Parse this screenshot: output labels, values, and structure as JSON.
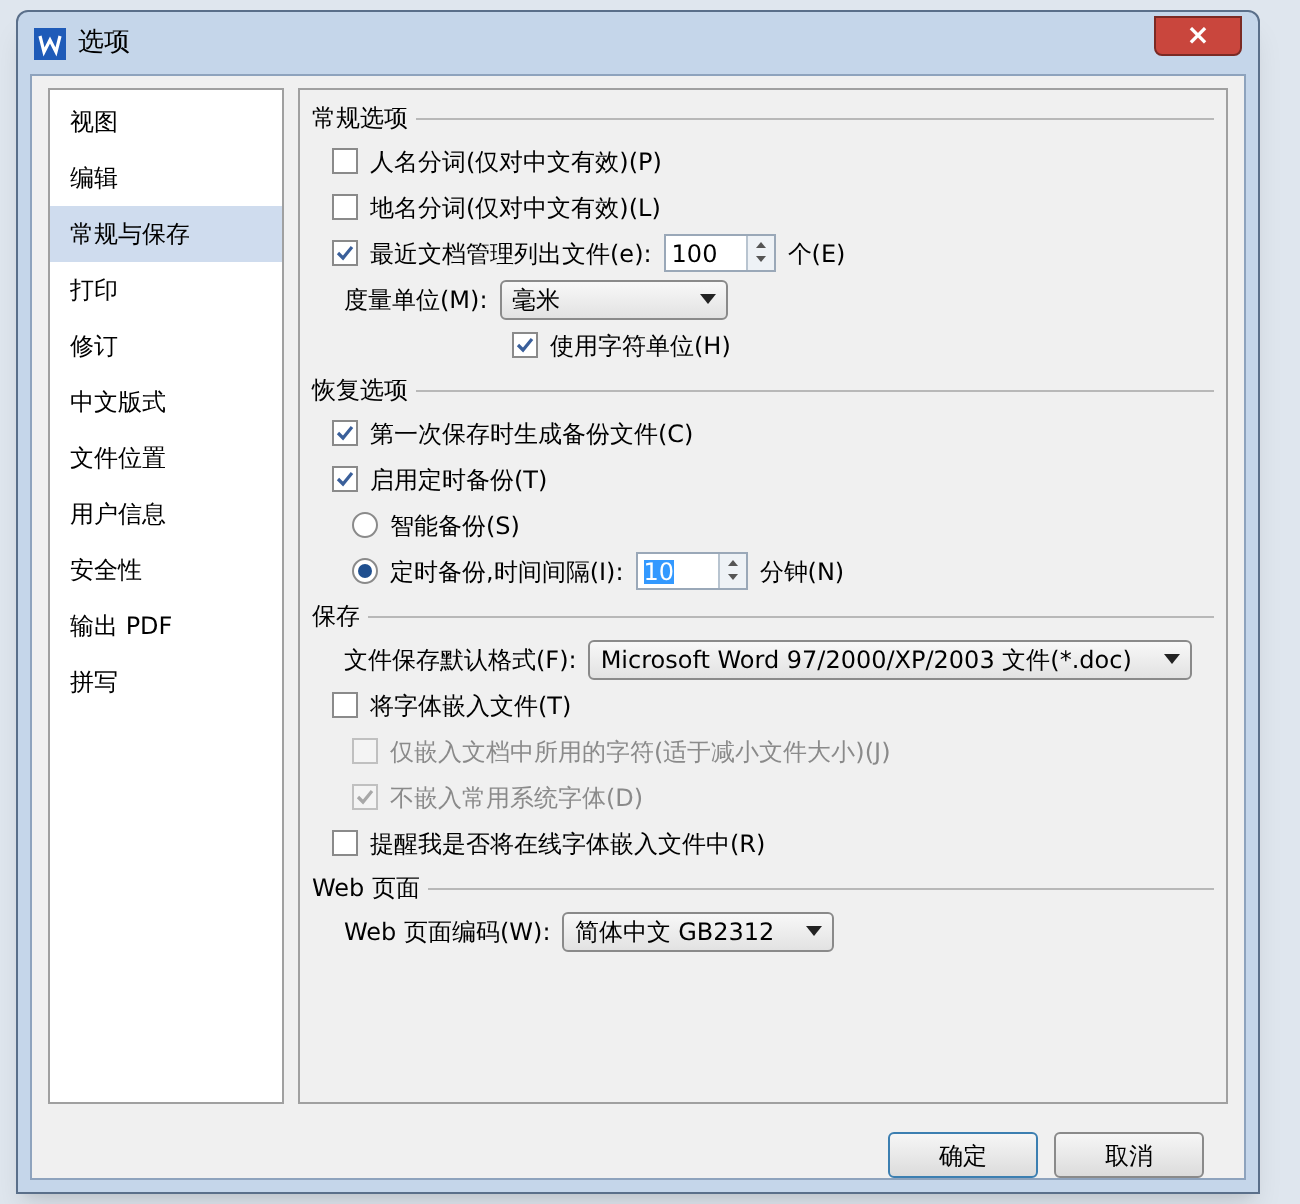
{
  "window": {
    "title": "选项",
    "close": "×"
  },
  "sidebar": {
    "items": [
      {
        "label": "视图",
        "selected": false
      },
      {
        "label": "编辑",
        "selected": false
      },
      {
        "label": "常规与保存",
        "selected": true
      },
      {
        "label": "打印",
        "selected": false
      },
      {
        "label": "修订",
        "selected": false
      },
      {
        "label": "中文版式",
        "selected": false
      },
      {
        "label": "文件位置",
        "selected": false
      },
      {
        "label": "用户信息",
        "selected": false
      },
      {
        "label": "安全性",
        "selected": false
      },
      {
        "label": "输出 PDF",
        "selected": false
      },
      {
        "label": "拼写",
        "selected": false
      }
    ]
  },
  "sections": [
    {
      "title": "常规选项",
      "items": [
        {
          "kind": "checkbox",
          "label": "人名分词(仅对中文有效)(P)",
          "checked": false,
          "disabled": false
        },
        {
          "kind": "checkbox",
          "label": "地名分词(仅对中文有效)(L)",
          "checked": false,
          "disabled": false
        },
        {
          "kind": "checkbox_spin",
          "label": "最近文档管理列出文件(e):",
          "checked": true,
          "disabled": false,
          "value": "100",
          "suffix": "个(E)"
        },
        {
          "kind": "select",
          "label": "度量单位(M):",
          "value": "毫米",
          "children": [
            {
              "kind": "checkbox",
              "label": "使用字符单位(H)",
              "checked": true,
              "disabled": false
            }
          ]
        }
      ]
    },
    {
      "title": "恢复选项",
      "items": [
        {
          "kind": "checkbox",
          "label": "第一次保存时生成备份文件(C)",
          "checked": true,
          "disabled": false
        },
        {
          "kind": "checkbox",
          "label": "启用定时备份(T)",
          "checked": true,
          "disabled": false,
          "children": [
            {
              "kind": "radio",
              "label": "智能备份(S)",
              "selected": false
            },
            {
              "kind": "radio_spin",
              "label": "定时备份,时间间隔(I):",
              "selected": true,
              "value": "10",
              "suffix": "分钟(N)"
            }
          ]
        }
      ]
    },
    {
      "title": "保存",
      "items": [
        {
          "kind": "select",
          "label": "文件保存默认格式(F):",
          "value": "Microsoft Word 97/2000/XP/2003 文件(*.doc)"
        },
        {
          "kind": "checkbox",
          "label": "将字体嵌入文件(T)",
          "checked": false,
          "disabled": false,
          "children": [
            {
              "kind": "checkbox",
              "label": "仅嵌入文档中所用的字符(适于减小文件大小)(J)",
              "checked": false,
              "disabled": true
            },
            {
              "kind": "checkbox",
              "label": "不嵌入常用系统字体(D)",
              "checked": true,
              "disabled": true
            }
          ]
        },
        {
          "kind": "checkbox",
          "label": "提醒我是否将在线字体嵌入文件中(R)",
          "checked": false,
          "disabled": false
        }
      ]
    },
    {
      "title": "Web 页面",
      "items": [
        {
          "kind": "select",
          "label": "Web 页面编码(W):",
          "value": "简体中文 GB2312"
        }
      ]
    }
  ],
  "buttons": [
    "确定",
    "取消"
  ]
}
